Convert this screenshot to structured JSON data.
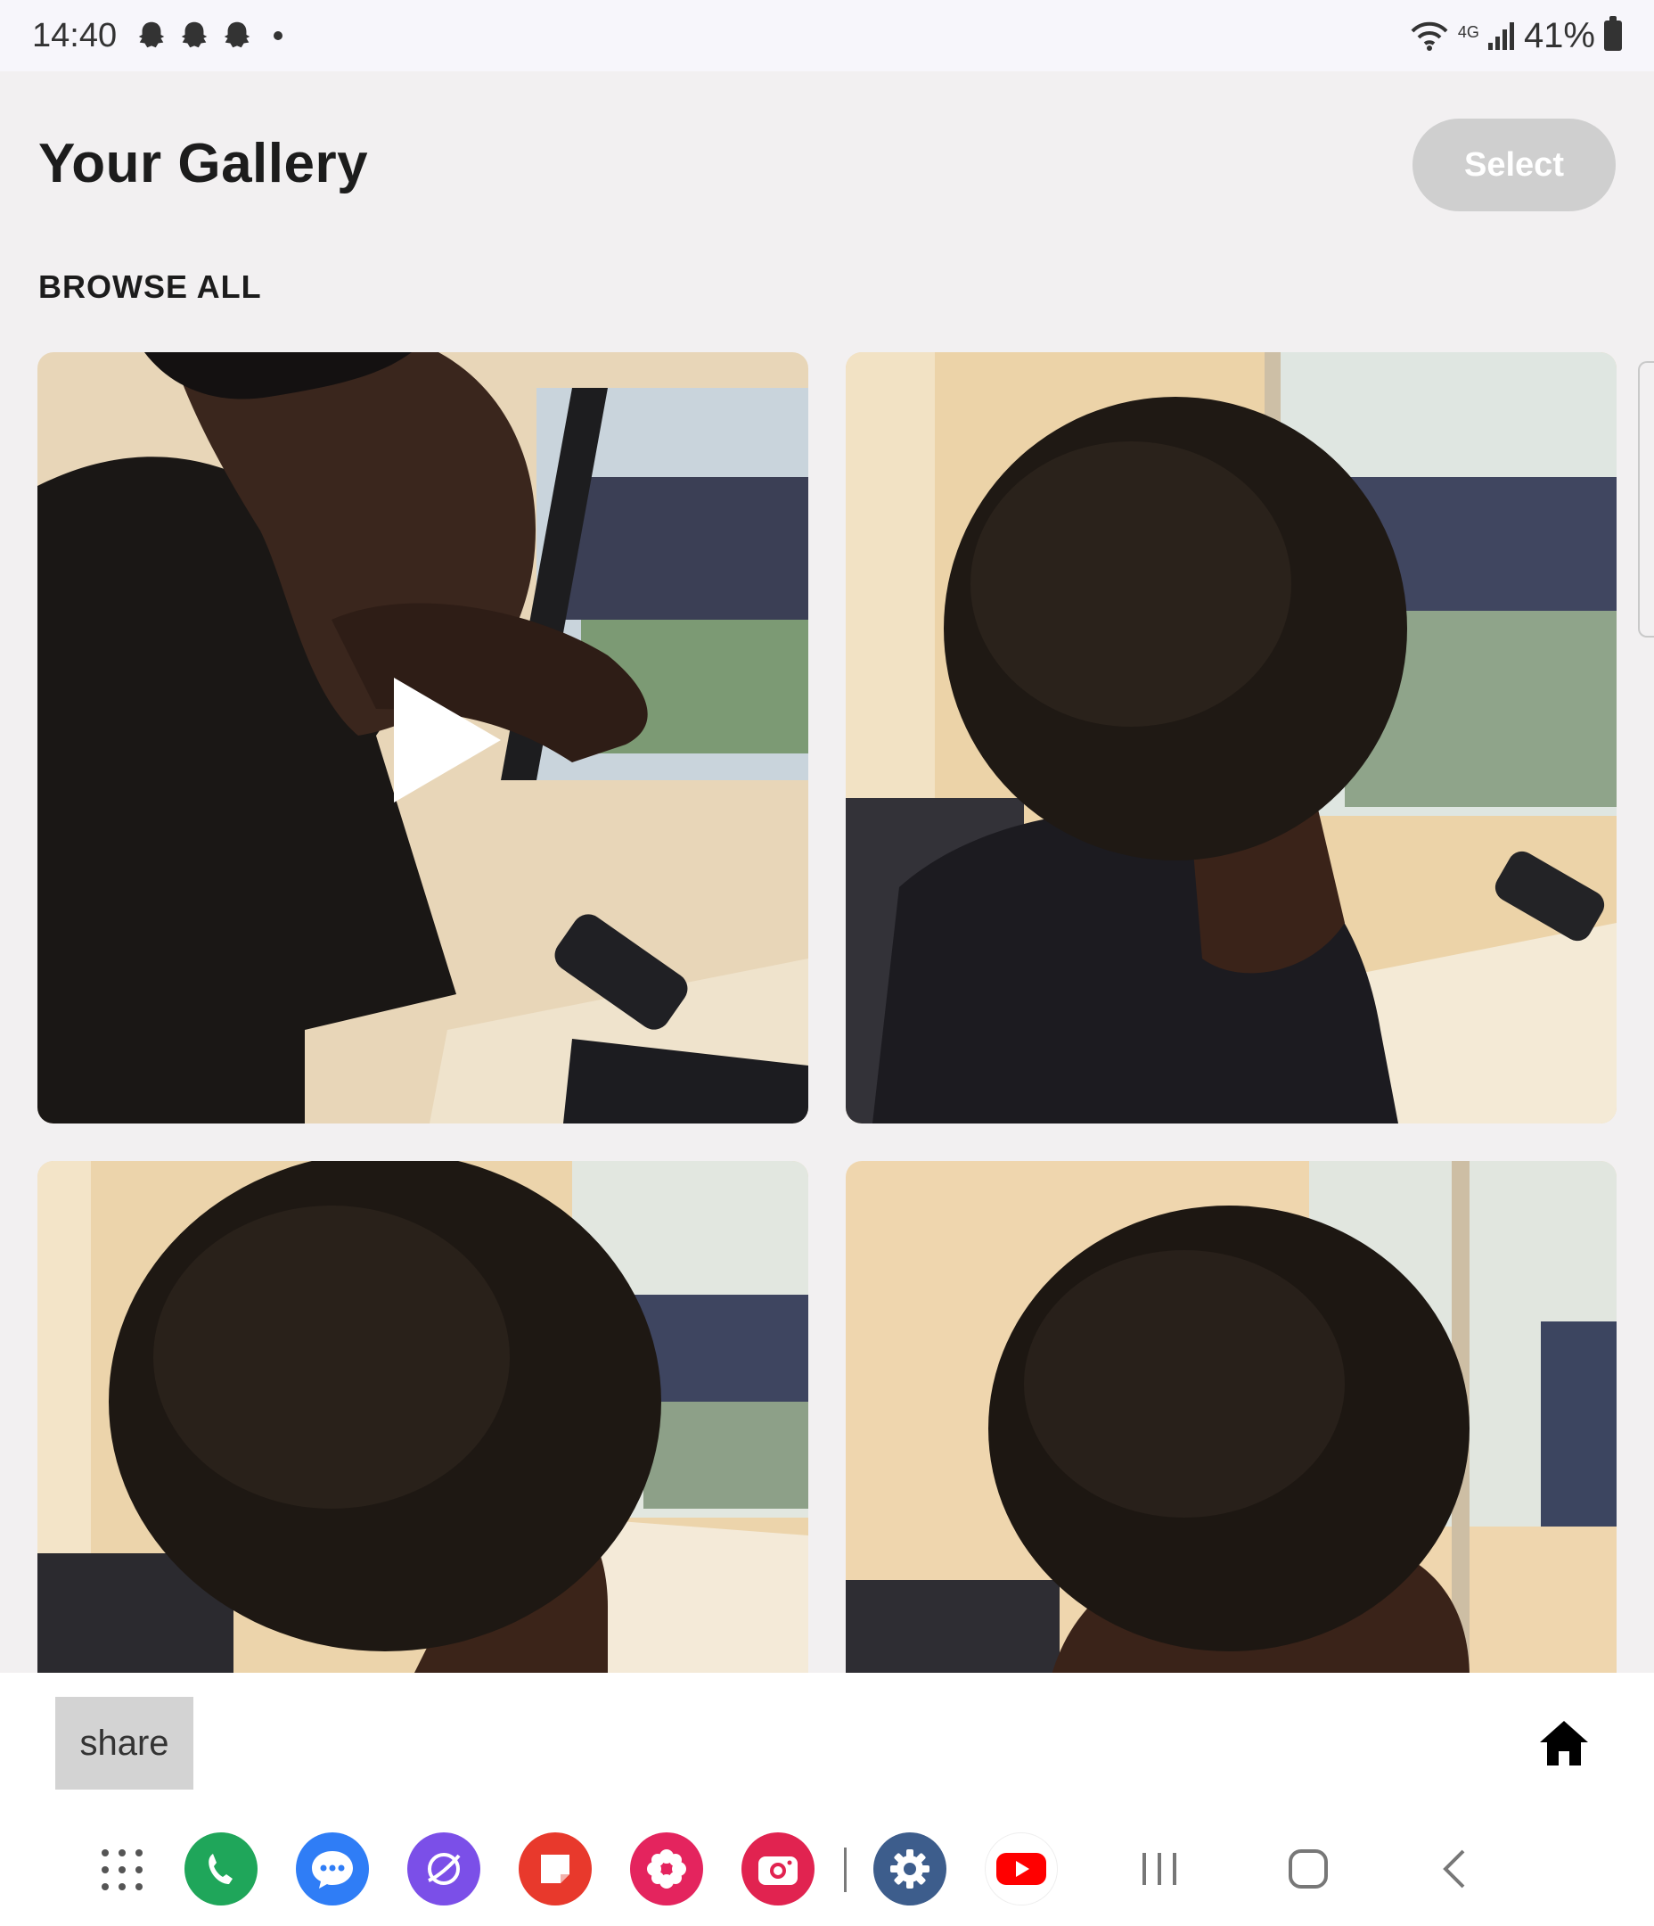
{
  "status_bar": {
    "time": "14:40",
    "notification_icons": [
      "snapchat-icon",
      "snapchat-icon",
      "snapchat-icon"
    ],
    "network": "4G",
    "battery_percent": "41%"
  },
  "header": {
    "title": "Your Gallery",
    "select_label": "Select"
  },
  "section": {
    "label": "BROWSE ALL"
  },
  "gallery": {
    "items": [
      {
        "type": "video",
        "icon": "play-icon"
      },
      {
        "type": "photo"
      },
      {
        "type": "photo"
      },
      {
        "type": "photo"
      }
    ]
  },
  "bottom_bar": {
    "share_label": "share",
    "home_icon": "home-icon"
  },
  "taskbar": {
    "apps": [
      "apps-grid-icon",
      "phone-icon",
      "messages-icon",
      "browser-icon",
      "notes-icon",
      "flower-icon",
      "camera-icon",
      "settings-icon",
      "youtube-icon"
    ],
    "nav": [
      "recents-icon",
      "home-nav-icon",
      "back-icon"
    ]
  },
  "colors": {
    "background": "#f2f0f1",
    "select_button": "#cfcfcf",
    "share_button": "#d3d3d3",
    "phone_app": "#1fa65a",
    "messages_app": "#2f7df6",
    "browser_app": "#7b4fe8",
    "notes_app": "#e8392c",
    "flower_app": "#e4245e",
    "camera_app": "#e12350",
    "settings_app": "#3d5d8c",
    "youtube_app": "#ff0000"
  }
}
